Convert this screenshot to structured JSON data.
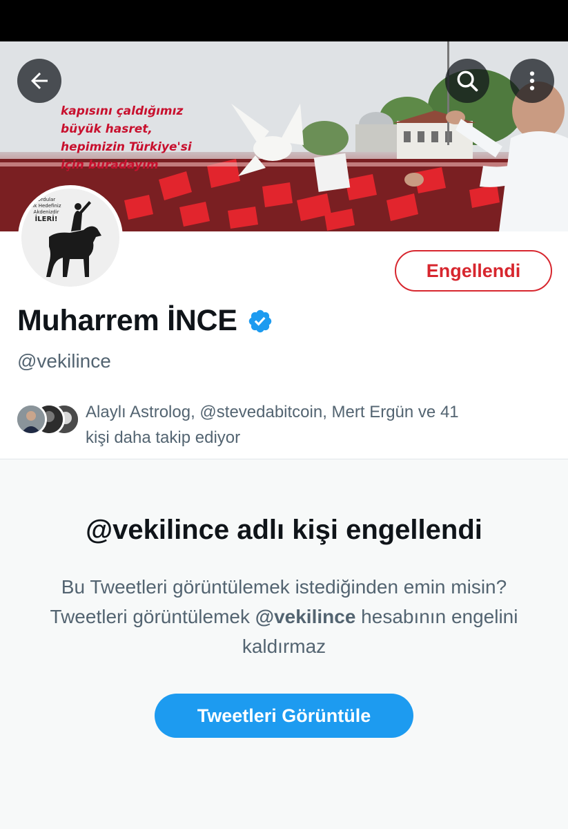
{
  "banner": {
    "lines": [
      "kapısını çaldığımız",
      "büyük hasret,",
      "hepimizin Türkiye'si",
      "için buradayım"
    ]
  },
  "header": {
    "back_icon": "arrow-left-icon",
    "search_icon": "search-icon",
    "more_icon": "more-vertical-icon"
  },
  "avatar": {
    "caption_lines": [
      "Ordular",
      "İlk Hedefiniz",
      "Akdenizdir",
      "İLERİ!"
    ]
  },
  "profile": {
    "blocked_button_label": "Engellendi",
    "name": "Muharrem İNCE",
    "verified_icon": "verified-badge-icon",
    "handle": "@vekilince",
    "followers_known_line1": "Alaylı Astrolog, @stevedabitcoin, Mert Ergün ve 41",
    "followers_known_line2": "kişi daha takip ediyor"
  },
  "blocked_notice": {
    "title": "@vekilince adlı kişi engellendi",
    "desc_part1": "Bu Tweetleri görüntülemek istediğinden emin misin? Tweetleri görüntülemek ",
    "desc_handle": "@vekilince",
    "desc_part2": " hesabının engelini kaldırmaz",
    "view_button_label": "Tweetleri Görüntüle"
  },
  "colors": {
    "accent_blue": "#1d9bf0",
    "blocked_red": "#d7262e",
    "secondary_text": "#536471",
    "primary_text": "#0f1419"
  }
}
